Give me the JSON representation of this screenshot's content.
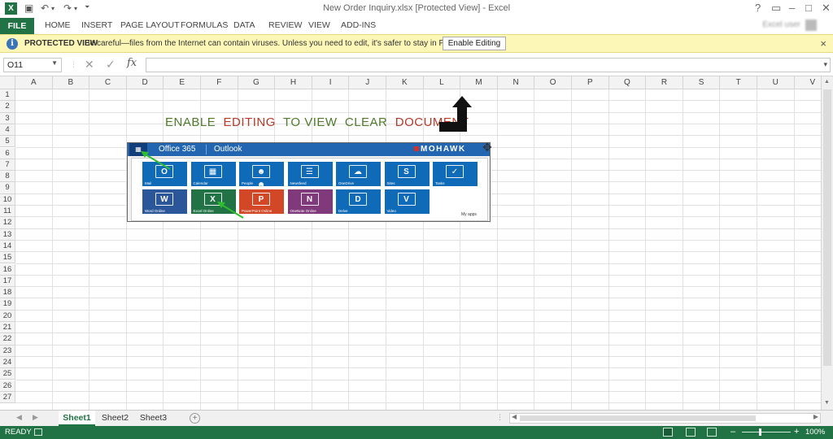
{
  "window": {
    "title": "New Order Inquiry.xlsx  [Protected View] - Excel",
    "app_logo": "X",
    "controls": [
      "?",
      "▭",
      "–",
      "□",
      "✕"
    ]
  },
  "quick_access": {
    "save_icon": "save-icon",
    "undo_icon": "undo-icon",
    "redo_icon": "redo-icon",
    "customize_icon": "customize-icon"
  },
  "ribbon": {
    "file_label": "FILE",
    "tabs": [
      "HOME",
      "INSERT",
      "PAGE LAYOUT",
      "FORMULAS",
      "DATA",
      "REVIEW",
      "VIEW",
      "ADD-INS"
    ],
    "user_name": "Excel user"
  },
  "protected_view": {
    "icon": "i",
    "label": "PROTECTED VIEW",
    "message": "Be careful—files from the Internet can contain viruses. Unless you need to edit, it's safer to stay in Protected View.",
    "button": "Enable Editing",
    "close": "×"
  },
  "formula_bar": {
    "name_box": "O11",
    "cancel": "✕",
    "enter": "✓",
    "fx": "fx",
    "formula": ""
  },
  "columns": [
    "A",
    "B",
    "C",
    "D",
    "E",
    "F",
    "G",
    "H",
    "I",
    "J",
    "K",
    "L",
    "M",
    "N",
    "O",
    "P",
    "Q",
    "R",
    "S",
    "T",
    "U",
    "V"
  ],
  "rows": [
    "1",
    "2",
    "3",
    "4",
    "5",
    "6",
    "7",
    "8",
    "9",
    "10",
    "11",
    "12",
    "13",
    "14",
    "15",
    "16",
    "17",
    "18",
    "19",
    "20",
    "21",
    "22",
    "23",
    "24",
    "25",
    "26",
    "27"
  ],
  "banner": {
    "words": [
      {
        "text": "ENABLE",
        "color": "#4e7a2a"
      },
      {
        "text": "EDITING",
        "color": "#b33a2a"
      },
      {
        "text": "TO VIEW",
        "color": "#4e7a2a"
      },
      {
        "text": "CLEAR",
        "color": "#4e7a2a"
      },
      {
        "text": "DOCUMENT",
        "color": "#b33a2a"
      }
    ]
  },
  "embedded_image": {
    "header": {
      "waffle": "▦",
      "product": "Office 365",
      "app": "Outlook",
      "brand": "MOHAWK"
    },
    "tiles": [
      {
        "label": "Mail",
        "icon": "O",
        "color": "#0f6bb8"
      },
      {
        "label": "Calendar",
        "icon": "▦",
        "color": "#0f6bb8"
      },
      {
        "label": "People",
        "icon": "☻☻",
        "color": "#0f6bb8"
      },
      {
        "label": "Newsfeed",
        "icon": "☰",
        "color": "#0f6bb8"
      },
      {
        "label": "OneDrive",
        "icon": "☁",
        "color": "#0f6bb8"
      },
      {
        "label": "Sites",
        "icon": "S",
        "color": "#0f6bb8"
      },
      {
        "label": "Tasks",
        "icon": "✓",
        "color": "#0f6bb8"
      },
      {
        "label": "Word Online",
        "icon": "W",
        "color": "#2b579a"
      },
      {
        "label": "Excel Online",
        "icon": "X",
        "color": "#217346"
      },
      {
        "label": "PowerPoint Online",
        "icon": "P",
        "color": "#d24726"
      },
      {
        "label": "OneNote Online",
        "icon": "N",
        "color": "#80397b"
      },
      {
        "label": "Delve",
        "icon": "D",
        "color": "#0f6bb8"
      },
      {
        "label": "Video",
        "icon": "V",
        "color": "#0f6bb8"
      }
    ],
    "my_apps": "My apps"
  },
  "sheets": {
    "tabs": [
      "Sheet1",
      "Sheet2",
      "Sheet3"
    ],
    "active": "Sheet1",
    "add": "+",
    "more": "⋮"
  },
  "status": {
    "ready": "READY",
    "zoom": "100%",
    "zoom_out": "–",
    "zoom_in": "+"
  },
  "colors": {
    "excel_green": "#217346",
    "protected_yellow": "#fcf7b6",
    "o365_blue": "#2266b2"
  }
}
